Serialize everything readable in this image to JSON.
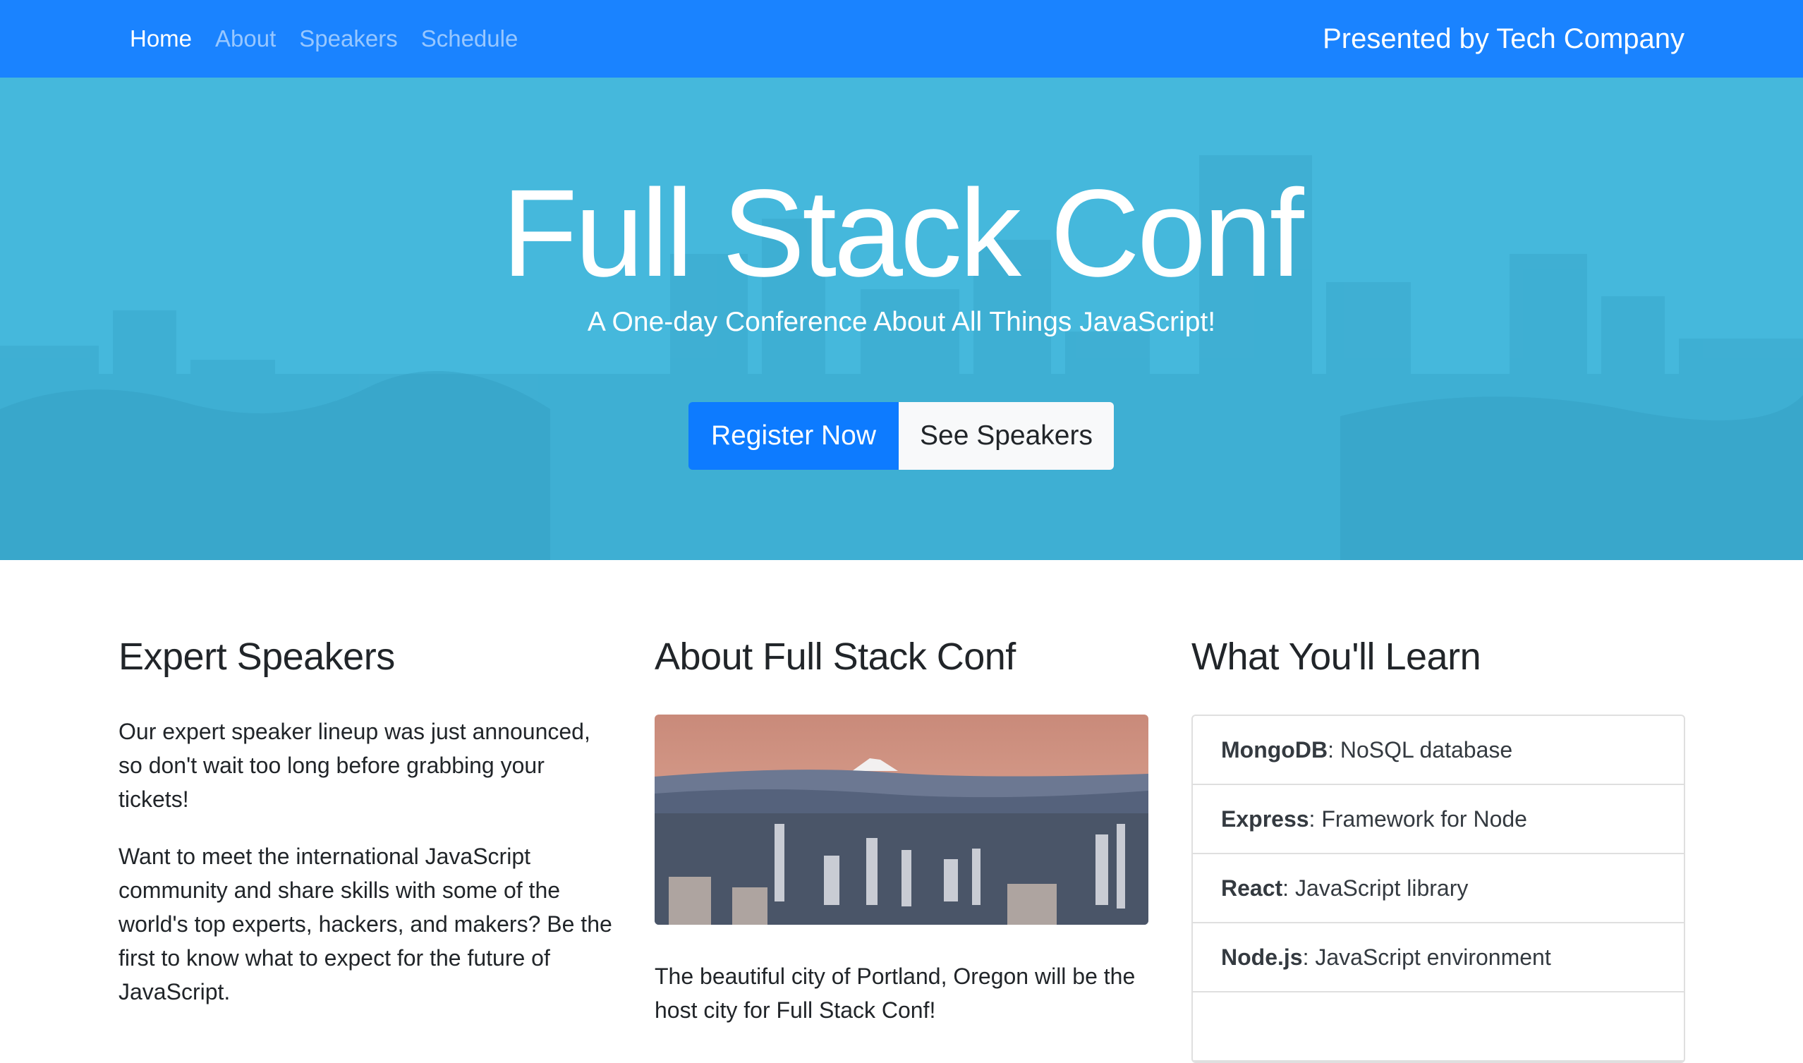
{
  "nav": {
    "links": [
      {
        "label": "Home",
        "active": true
      },
      {
        "label": "About",
        "active": false
      },
      {
        "label": "Speakers",
        "active": false
      },
      {
        "label": "Schedule",
        "active": false
      }
    ],
    "brand": "Presented by Tech Company"
  },
  "hero": {
    "title": "Full Stack Conf",
    "subtitle": "A One-day Conference About All Things JavaScript!",
    "primary_button": "Register Now",
    "secondary_button": "See Speakers"
  },
  "speakers": {
    "heading": "Expert Speakers",
    "p1": "Our expert speaker lineup was just announced, so don't wait too long before grabbing your tickets!",
    "p2": "Want to meet the international JavaScript community and share skills with some of the world's top experts, hackers, and makers? Be the first to know what to expect for the future of JavaScript."
  },
  "about": {
    "heading": "About Full Stack Conf",
    "text": "The beautiful city of Portland, Oregon will be the host city for Full Stack Conf!"
  },
  "learn": {
    "heading": "What You'll Learn",
    "items": [
      {
        "term": "MongoDB",
        "desc": ": NoSQL database"
      },
      {
        "term": "Express",
        "desc": ": Framework for Node"
      },
      {
        "term": "React",
        "desc": ": JavaScript library"
      },
      {
        "term": "Node.js",
        "desc": ": JavaScript environment"
      }
    ]
  },
  "colors": {
    "navbar": "#1a83ff",
    "hero": "#45b8dc",
    "primary": "#0d7bff"
  }
}
